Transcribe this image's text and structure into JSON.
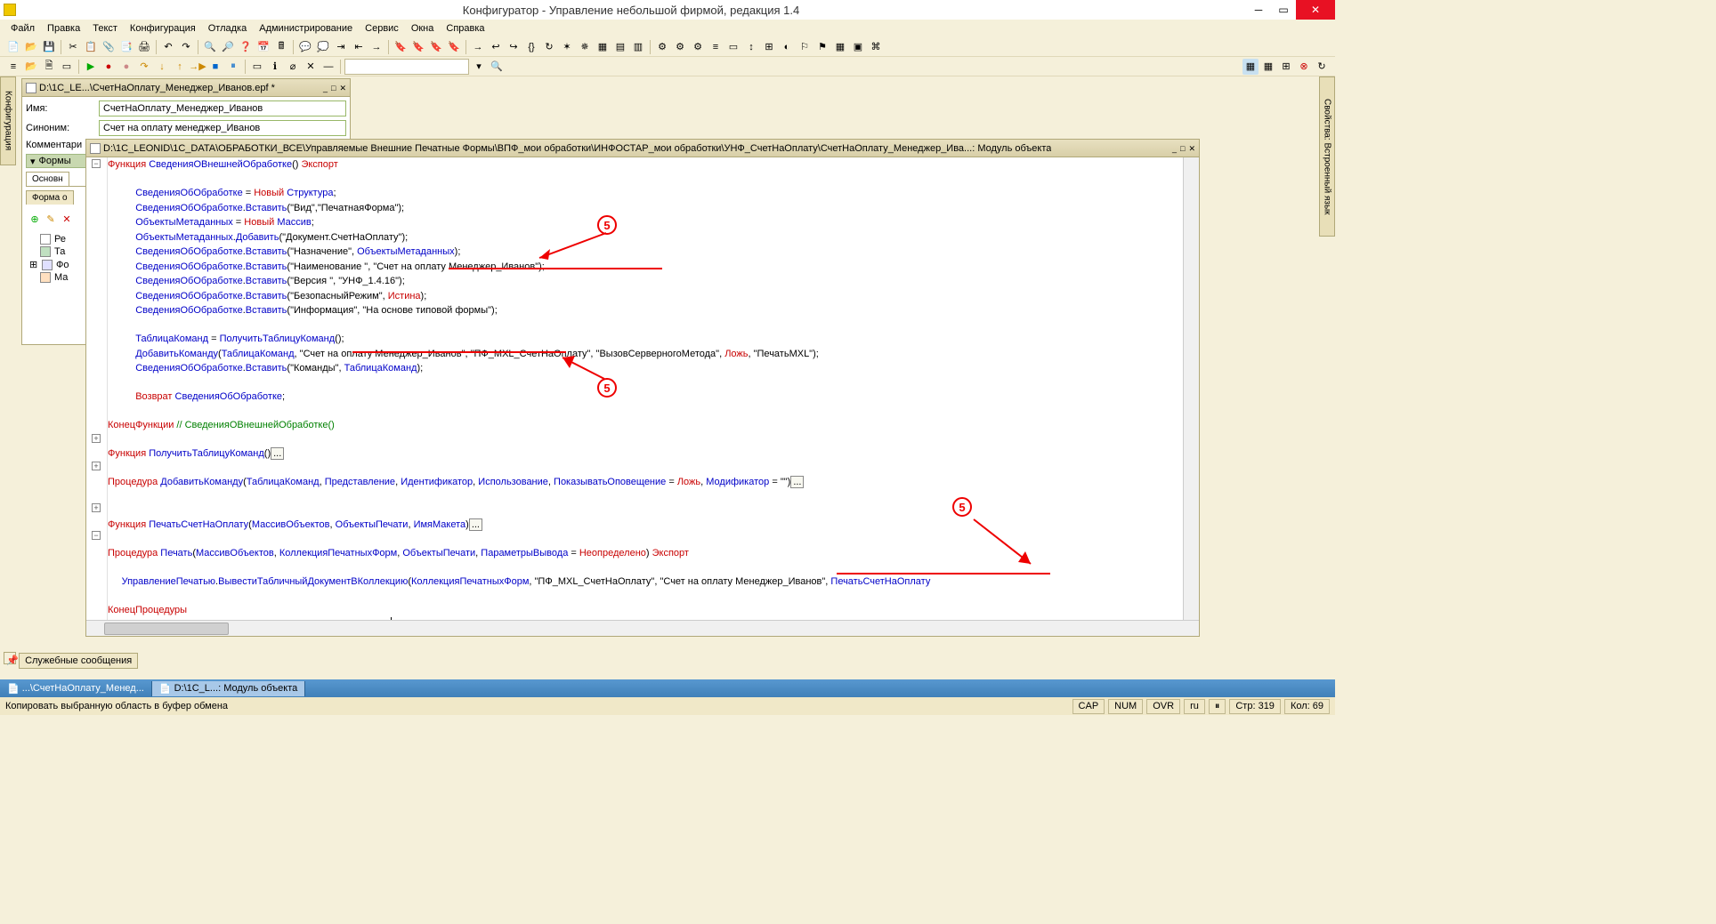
{
  "title": "Конфигуратор - Управление небольшой фирмой, редакция 1.4",
  "menu": [
    "Файл",
    "Правка",
    "Текст",
    "Конфигурация",
    "Отладка",
    "Администрирование",
    "Сервис",
    "Окна",
    "Справка"
  ],
  "side_tab_left": "Конфигурация",
  "side_tab_right": "Свойства: Встроенный язык",
  "prop_window": {
    "title": "D:\\1С_LE...\\СчетНаОплату_Менеджер_Иванов.epf *",
    "rows": {
      "name_label": "Имя:",
      "name_value": "СчетНаОплату_Менеджер_Иванов",
      "synonym_label": "Синоним:",
      "synonym_value": "Счет на оплату менеджер_Иванов",
      "comment_label": "Комментари"
    },
    "forms_section": "Формы",
    "tab_main": "Основн",
    "tab_form": "Форма о",
    "tree": {
      "re": "Ре",
      "ta": "Та",
      "fo": "Фо",
      "ma": "Ма"
    }
  },
  "code_window": {
    "title": "D:\\1C_LEONID\\1C_DATA\\ОБРАБОТКИ_ВСЕ\\Управляемые Внешние Печатные Формы\\ВПФ_мои обработки\\ИНФОСТАР_мои обработки\\УНФ_СчетНаОплату\\СчетНаОплату_Менеджер_Ива...: Модуль объекта"
  },
  "annotations": {
    "num": "5"
  },
  "svc_messages": "Служебные сообщения",
  "task_tabs": {
    "tab1": "...\\СчетНаОплату_Менед...",
    "tab2": "D:\\1С_L...: Модуль объекта"
  },
  "status": {
    "text": "Копировать выбранную область в буфер обмена",
    "cap": "CAP",
    "num": "NUM",
    "ovr": "OVR",
    "lang": "ru",
    "line": "Стр: 319",
    "col": "Кол: 69"
  },
  "code": {
    "l1a": "Функция ",
    "l1b": "СведенияОВнешнейОбработке",
    "l1c": "()",
    "l1d": " Экспорт",
    "l2a": "СведенияОбОбработке",
    "l2b": " = ",
    "l2c": "Новый ",
    "l2d": "Структура",
    "l3a": "СведенияОбОбработке",
    "l3b": ".",
    "l3c": "Вставить",
    "l3d": "(",
    "l3e": "\"Вид\"",
    "l3f": ",",
    "l3g": "\"ПечатнаяФорма\"",
    "l3h": ");",
    "l4a": "ОбъектыМетаданных",
    "l4b": " = ",
    "l4c": "Новый ",
    "l4d": "Массив",
    "l5a": "ОбъектыМетаданных",
    "l5b": ".",
    "l5c": "Добавить",
    "l5d": "(",
    "l5e": "\"Документ.СчетНаОплату\"",
    "l5f": ");",
    "l6a": "СведенияОбОбработке",
    "l6b": ".",
    "l6c": "Вставить",
    "l6d": "(",
    "l6e": "\"Назначение\"",
    "l6f": ", ",
    "l6g": "ОбъектыМетаданных",
    "l6h": ");",
    "l7a": "СведенияОбОбработке",
    "l7b": ".",
    "l7c": "Вставить",
    "l7d": "(",
    "l7e": "\"Наименование \"",
    "l7f": ", ",
    "l7g": "\"Счет на оплату Менеджер_Иванов\"",
    "l7h": ");",
    "l8a": "СведенияОбОбработке",
    "l8b": ".",
    "l8c": "Вставить",
    "l8d": "(",
    "l8e": "\"Версия \"",
    "l8f": ", ",
    "l8g": "\"УНФ_1.4.16\"",
    "l8h": ");",
    "l9a": "СведенияОбОбработке",
    "l9b": ".",
    "l9c": "Вставить",
    "l9d": "(",
    "l9e": "\"БезопасныйРежим\"",
    "l9f": ", ",
    "l9g": "Истина",
    "l9h": ");",
    "l10a": "СведенияОбОбработке",
    "l10b": ".",
    "l10c": "Вставить",
    "l10d": "(",
    "l10e": "\"Информация\"",
    "l10f": ", ",
    "l10g": "\"На основе типовой формы\"",
    "l10h": ");",
    "l11a": "ТаблицаКоманд",
    "l11b": " = ",
    "l11c": "ПолучитьТаблицуКоманд",
    "l11d": "();",
    "l12a": "ДобавитьКоманду",
    "l12b": "(",
    "l12c": "ТаблицаКоманд",
    "l12d": ", ",
    "l12e": "\"Счет на оплату Менеджер_Иванов\"",
    "l12f": ", ",
    "l12g": "\"ПФ_MXL_СчетНаОплату\"",
    "l12h": ", ",
    "l12i": "\"ВызовСерверногоМетода\"",
    "l12j": ", ",
    "l12k": "Ложь",
    "l12l": ", ",
    "l12m": "\"ПечатьMXL\"",
    "l12n": ");",
    "l13a": "СведенияОбОбработке",
    "l13b": ".",
    "l13c": "Вставить",
    "l13d": "(",
    "l13e": "\"Команды\"",
    "l13f": ", ",
    "l13g": "ТаблицаКоманд",
    "l13h": ");",
    "l14a": "Возврат ",
    "l14b": "СведенияОбОбработке",
    "l15a": "КонецФункции",
    "l15b": " // СведенияОВнешнейОбработке()",
    "l16a": "Функция ",
    "l16b": "ПолучитьТаблицуКоманд",
    "l16c": "()",
    "l16d": "...",
    "l17a": "Процедура ",
    "l17b": "ДобавитьКоманду",
    "l17c": "(",
    "l17d": "ТаблицаКоманд",
    "l17e": ", ",
    "l17f": "Представление",
    "l17g": ", ",
    "l17h": "Идентификатор",
    "l17i": ", ",
    "l17j": "Использование",
    "l17k": ", ",
    "l17l": "ПоказыватьОповещение",
    "l17m": " = ",
    "l17n": "Ложь",
    "l17o": ", ",
    "l17p": "Модификатор",
    "l17q": " = ",
    "l17r": "\"\"",
    "l17s": ")",
    "l17t": "...",
    "l18a": "Функция ",
    "l18b": "ПечатьСчетНаОплату",
    "l18c": "(",
    "l18d": "МассивОбъектов",
    "l18e": ", ",
    "l18f": "ОбъектыПечати",
    "l18g": ", ",
    "l18h": "ИмяМакета",
    "l18i": ")",
    "l18j": "...",
    "l19a": "Процедура ",
    "l19b": "Печать",
    "l19c": "(",
    "l19d": "МассивОбъектов",
    "l19e": ", ",
    "l19f": "КоллекцияПечатныхФорм",
    "l19g": ", ",
    "l19h": "ОбъектыПечати",
    "l19i": ", ",
    "l19j": "ПараметрыВывода",
    "l19k": " = ",
    "l19l": "Неопределено",
    "l19m": ") ",
    "l19n": "Экспорт",
    "l20a": "УправлениеПечатью",
    "l20b": ".",
    "l20c": "ВывестиТабличныйДокументВКоллекцию",
    "l20d": "(",
    "l20e": "КоллекцияПечатныхФорм",
    "l20f": ", ",
    "l20g": "\"ПФ_MXL_СчетНаОплату\"",
    "l20h": ", ",
    "l20i": "\"Счет на оплату Менеджер_Иванов\"",
    "l20j": ", ",
    "l20k": "ПечатьСчетНаОплату",
    "l21a": "КонецПроцедуры"
  }
}
